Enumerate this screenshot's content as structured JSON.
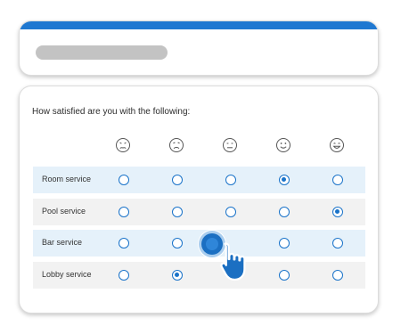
{
  "survey": {
    "question": "How satisfied are you with the following:",
    "scale_icons": [
      "very-dissatisfied-face-icon",
      "dissatisfied-face-icon",
      "neutral-face-icon",
      "satisfied-face-icon",
      "very-satisfied-face-icon"
    ],
    "rows": [
      {
        "label": "Room service",
        "selected_index": 3
      },
      {
        "label": "Pool service",
        "selected_index": 4
      },
      {
        "label": "Bar service",
        "selected_index": 2
      },
      {
        "label": "Lobby service",
        "selected_index": 1
      }
    ],
    "colors": {
      "accent": "#1a73c9",
      "top_bar": "#1f78d1",
      "row_shaded": "#e5f1fa",
      "row_plain": "#f2f2f2"
    }
  },
  "cursor": "hand-pointer-icon"
}
